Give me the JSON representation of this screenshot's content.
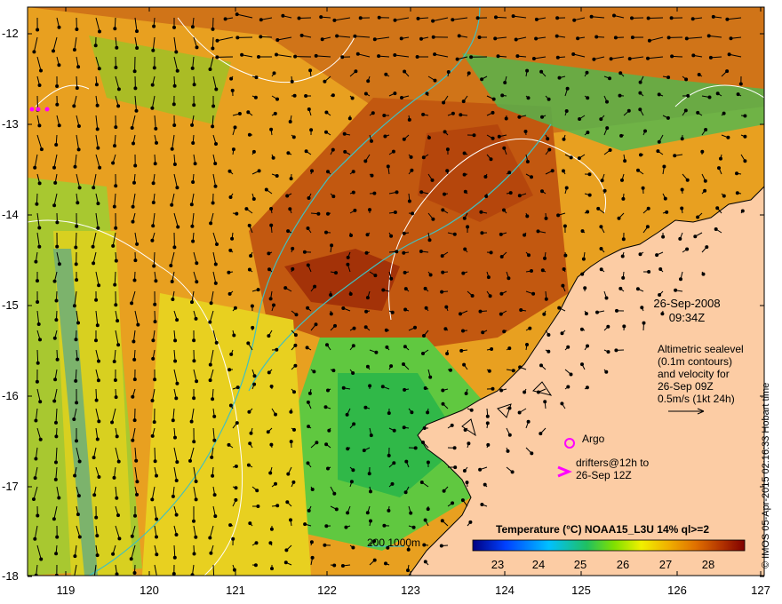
{
  "map": {
    "x_ticks": [
      "119",
      "120",
      "121",
      "122",
      "123",
      "124",
      "125",
      "126",
      "127"
    ],
    "y_ticks": [
      "-12",
      "-13",
      "-14",
      "-15",
      "-16",
      "-17",
      "-18"
    ],
    "lon_range": [
      118.6,
      127.0
    ],
    "lat_range": [
      -18.0,
      -11.8
    ],
    "land_color": "#fccca4",
    "contour_color": "#ffffff",
    "isobath_color": "#40c0c0",
    "arrow_color": "#000000"
  },
  "annotations": {
    "date": "26-Sep-2008",
    "time": "09:34Z",
    "altimetry_lines": [
      "Altimetric sealevel",
      "(0.1m contours)",
      "and velocity for",
      "26-Sep 09Z",
      "0.5m/s (1kt 24h)"
    ],
    "argo_label": "Argo",
    "drifters_line1": "drifters@12h to",
    "drifters_line2": "26-Sep 12Z",
    "scale_label": "200  1000m",
    "credit": "© IMOS 05-Apr-2015 02:16:33 Hobart time"
  },
  "colorbar": {
    "title": "Temperature (°C) NOAA15_L3U 14% ql>=2",
    "ticks": [
      "23",
      "24",
      "25",
      "26",
      "27",
      "28"
    ],
    "range": [
      22.5,
      28.9
    ],
    "colors": [
      "#000080",
      "#0040ff",
      "#00c0ff",
      "#20c060",
      "#80e000",
      "#f0f000",
      "#f0b000",
      "#e07000",
      "#b03000",
      "#800000"
    ]
  }
}
